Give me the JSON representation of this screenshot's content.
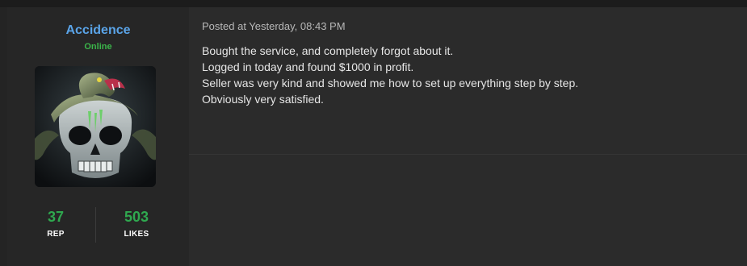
{
  "author": {
    "username": "Accidence",
    "status": "Online",
    "avatar_icon": "snake-skull-avatar",
    "stats": [
      {
        "value": "37",
        "label": "REP"
      },
      {
        "value": "503",
        "label": "LIKES"
      }
    ]
  },
  "post": {
    "posted_at": "Posted at Yesterday, 08:43 PM",
    "lines": [
      "Bought the service, and completely forgot about it.",
      "Logged in today and found $1000 in profit.",
      "Seller was very kind and showed me how to set up everything step by step.",
      "Obviously very satisfied."
    ]
  },
  "colors": {
    "username": "#5aa4e8",
    "online": "#3bb54a",
    "stat_value": "#2fa84f",
    "background": "#2b2b2b"
  }
}
